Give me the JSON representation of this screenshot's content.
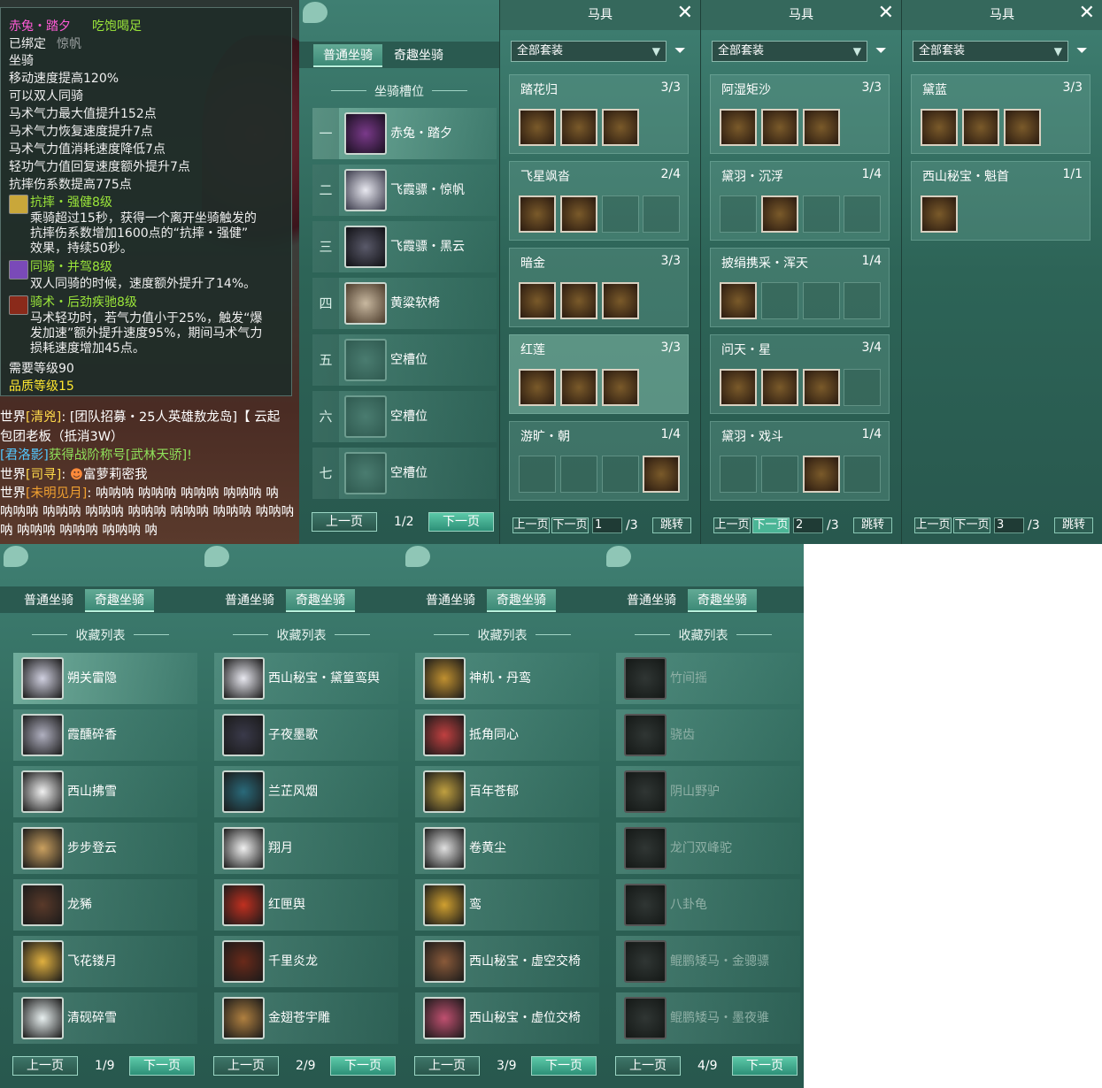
{
  "tooltip": {
    "name": "赤兔・踏夕",
    "state": "吃饱喝足",
    "bound_label": "已绑定",
    "bound_faded": "惊帆",
    "type": "坐骑",
    "stats": [
      "移动速度提高120%",
      "可以双人同骑",
      "马术气力最大值提升152点",
      "马术气力恢复速度提升7点",
      "马术气力值消耗速度降低7点",
      "轻功气力值回复速度额外提升7点",
      "抗摔伤系数提高775点"
    ],
    "skills": [
      {
        "name": "抗摔・强健8级",
        "lines": [
          "乘骑超过15秒，获得一个离开坐骑触发的",
          "抗摔伤系数增加1600点的“抗摔・强健”",
          "效果，持续50秒。"
        ],
        "color": "#c9a73a"
      },
      {
        "name": "同骑・并驾8级",
        "lines": [
          "双人同骑的时候，速度额外提升了14%。"
        ],
        "color": "#7a4ab8"
      },
      {
        "name": "骑术・后劲疾驰8级",
        "lines": [
          "马术轻功时，若气力值小于25%，触发“爆",
          "发加速”额外提升速度95%，期间马术气力",
          "损耗速度增加45点。"
        ],
        "color": "#8a2a1a"
      }
    ],
    "require_level": "需要等级90",
    "quality_level": "品质等级15"
  },
  "chat": [
    {
      "channel": "世界",
      "user": "[清兇]",
      "text": "[团队招募・25人英雄敖龙岛]【 云起"
    },
    {
      "text": "包团老板（抵消3W）"
    },
    {
      "user": "[君洛影]",
      "text": "获得战阶称号[武林天骄]!"
    },
    {
      "channel": "世界",
      "user": "[司寻]",
      "text": "富萝莉密我"
    },
    {
      "channel": "世界",
      "user": "[未明见月]",
      "text": "呐呐呐 呐呐呐 呐呐呐 呐呐呐 呐"
    },
    {
      "text": "呐呐呐 呐呐呐 呐呐呐 呐呐呐 呐呐呐 呐呐呐 呐呐呐"
    },
    {
      "text": "呐 呐呐呐 呐呐呐 呐呐呐 呐"
    }
  ],
  "mount_slots": {
    "tabs": [
      "普通坐骑",
      "奇趣坐骑"
    ],
    "title": "坐骑槽位",
    "slots": [
      {
        "num": "一",
        "label": "赤兔・踏夕"
      },
      {
        "num": "二",
        "label": "飞霞骠・惊帆"
      },
      {
        "num": "三",
        "label": "飞霞骠・黑云"
      },
      {
        "num": "四",
        "label": "黄粱软椅"
      },
      {
        "num": "五",
        "label": "空槽位"
      },
      {
        "num": "六",
        "label": "空槽位"
      },
      {
        "num": "七",
        "label": "空槽位"
      }
    ],
    "prev": "上一页",
    "next": "下一页",
    "page": "1/2"
  },
  "gear_panels": [
    {
      "title": "马具",
      "filter": "全部套装",
      "page_input": "1",
      "page_total": "/3",
      "suits": [
        {
          "name": "踏花归",
          "count": "3/3",
          "filled": [
            true,
            true,
            true
          ]
        },
        {
          "name": "飞星飒沓",
          "count": "2/4",
          "filled": [
            true,
            true,
            false,
            false
          ]
        },
        {
          "name": "暗金",
          "count": "3/3",
          "filled": [
            true,
            true,
            true
          ]
        },
        {
          "name": "红莲",
          "count": "3/3",
          "filled": [
            true,
            true,
            true
          ]
        },
        {
          "name": "游旷・朝",
          "count": "1/4",
          "filled": [
            false,
            false,
            false,
            true
          ]
        }
      ]
    },
    {
      "title": "马具",
      "filter": "全部套装",
      "page_input": "2",
      "page_total": "/3",
      "suits": [
        {
          "name": "阿湿矩沙",
          "count": "3/3",
          "filled": [
            true,
            true,
            true
          ]
        },
        {
          "name": "黛羽・沉浮",
          "count": "1/4",
          "filled": [
            false,
            true,
            false,
            false
          ]
        },
        {
          "name": "披绢携采・浑天",
          "count": "1/4",
          "filled": [
            true,
            false,
            false,
            false
          ]
        },
        {
          "name": "问天・星",
          "count": "3/4",
          "filled": [
            true,
            true,
            true,
            false
          ]
        },
        {
          "name": "黛羽・戏斗",
          "count": "1/4",
          "filled": [
            false,
            false,
            true,
            false
          ]
        }
      ]
    },
    {
      "title": "马具",
      "filter": "全部套装",
      "page_input": "3",
      "page_total": "/3",
      "suits": [
        {
          "name": "黛蓝",
          "count": "3/3",
          "filled": [
            true,
            true,
            true
          ]
        },
        {
          "name": "西山秘宝・魁首",
          "count": "1/1",
          "filled": [
            true
          ]
        }
      ]
    }
  ],
  "gear_footer": {
    "prev": "上一页",
    "next": "下一页",
    "jump": "跳转"
  },
  "collections": [
    {
      "tabs": [
        "普通坐骑",
        "奇趣坐骑"
      ],
      "title": "收藏列表",
      "page": "1/9",
      "items": [
        "朔关雷隐",
        "霞醺碎香",
        "西山拂雪",
        "步步登云",
        "龙豨",
        "飞花镂月",
        "清砚碎雪"
      ],
      "gray": false
    },
    {
      "tabs": [
        "普通坐骑",
        "奇趣坐骑"
      ],
      "title": "收藏列表",
      "page": "2/9",
      "items": [
        "西山秘宝・黛篁鸾舆",
        "子夜墨歌",
        "兰芷风烟",
        "翔月",
        "红匣舆",
        "千里炎龙",
        "金翅苍宇雕"
      ],
      "gray": false
    },
    {
      "tabs": [
        "普通坐骑",
        "奇趣坐骑"
      ],
      "title": "收藏列表",
      "page": "3/9",
      "items": [
        "神机・丹鸾",
        "抵角同心",
        "百年苍郁",
        "卷黄尘",
        "鸾",
        "西山秘宝・虚空交椅",
        "西山秘宝・虚位交椅"
      ],
      "gray": false
    },
    {
      "tabs": [
        "普通坐骑",
        "奇趣坐骑"
      ],
      "title": "收藏列表",
      "page": "4/9",
      "items": [
        "竹间摇",
        "骁齿",
        "阴山野驴",
        "龙门双峰驼",
        "八卦龟",
        "鲲鹏矮马・金骢骠",
        "鲲鹏矮马・墨夜骓"
      ],
      "gray": true
    }
  ],
  "collection_footer": {
    "prev": "上一页",
    "next": "下一页"
  }
}
